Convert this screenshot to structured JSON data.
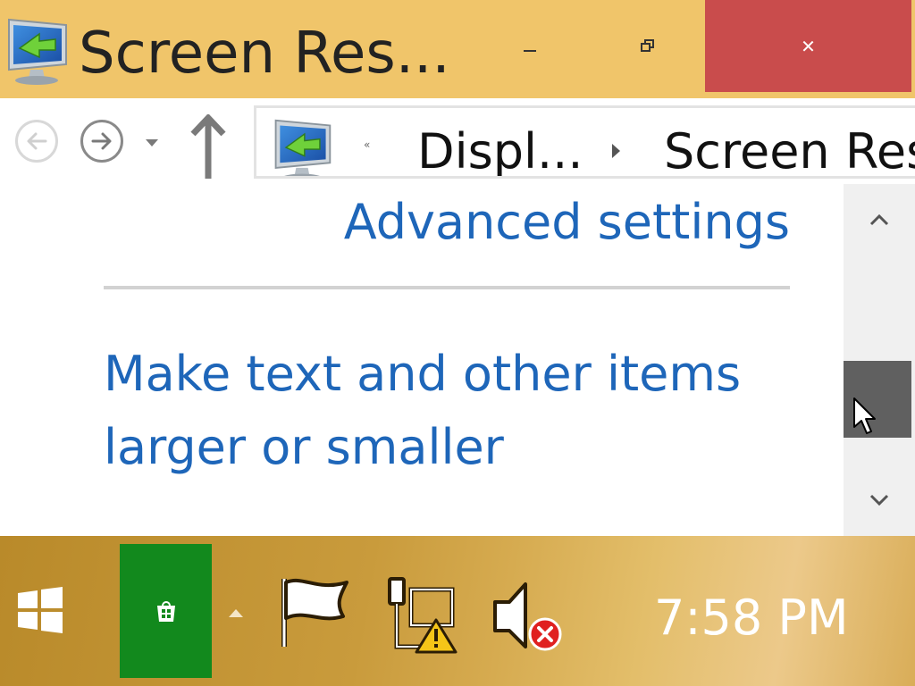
{
  "window": {
    "title": "Screen Res...",
    "controls": {
      "minimize": "minimize",
      "maximize": "restore",
      "close": "✕"
    }
  },
  "nav": {
    "back": "back",
    "forward": "forward",
    "recent": "recent-locations",
    "up": "up",
    "breadcrumb_overflow": "«",
    "breadcrumb": [
      "Displ...",
      "Screen Res"
    ]
  },
  "content": {
    "advanced_settings": "Advanced settings",
    "make_text_link": "Make text and other items larger or smaller"
  },
  "scrollbar": {
    "position": 0.62
  },
  "taskbar": {
    "clock": "7:58 PM",
    "tray_icons": [
      "action-center-flag-icon",
      "network-warning-icon",
      "volume-muted-icon"
    ],
    "accent_colors": {
      "store_tile": "#12891d",
      "close_button": "#c94c4c",
      "link": "#1e66b9"
    }
  }
}
